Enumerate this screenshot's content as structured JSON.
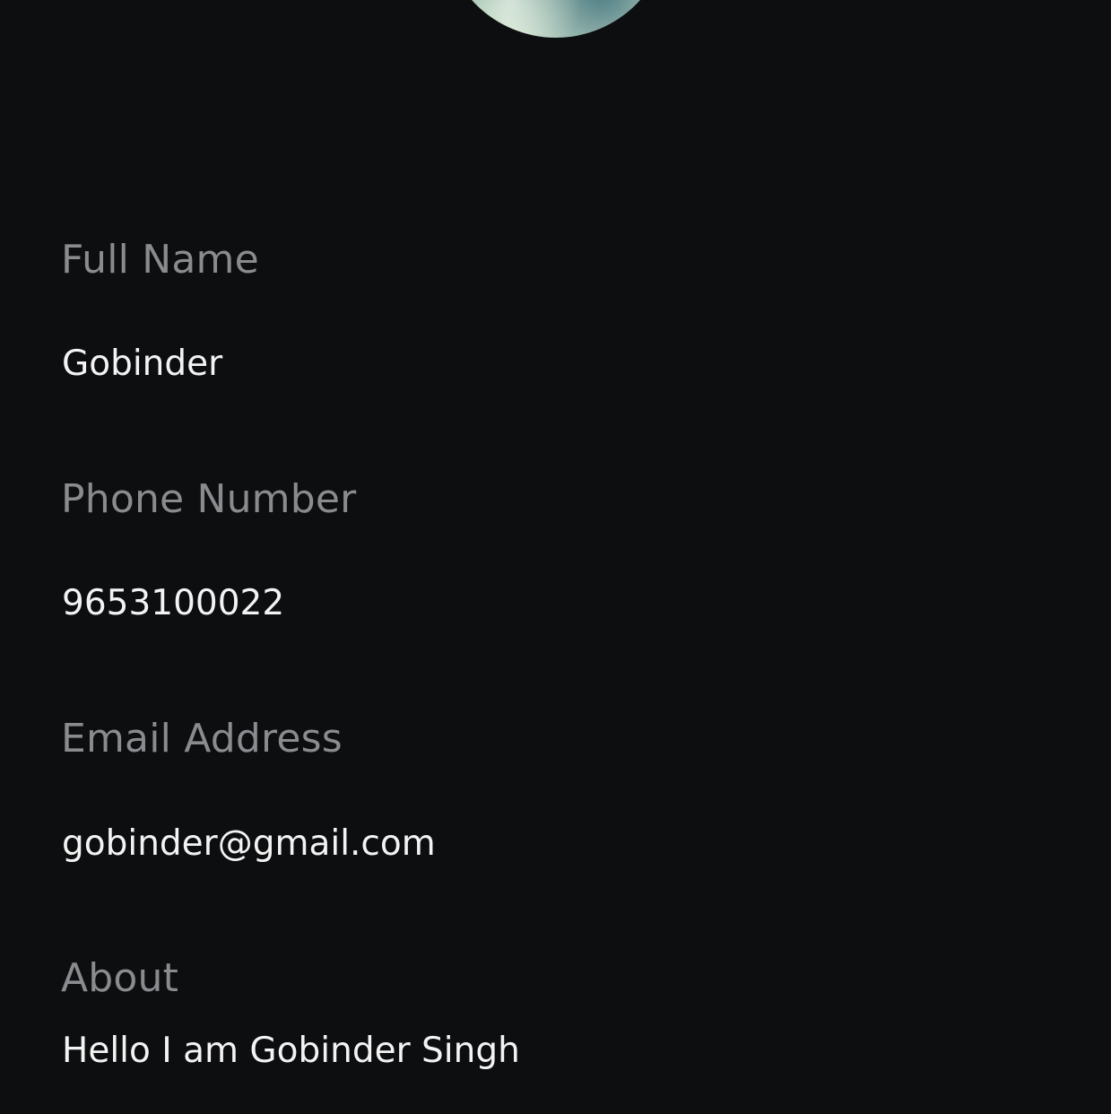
{
  "profile": {
    "fields": [
      {
        "label": "Full Name",
        "value": "Gobinder"
      },
      {
        "label": "Phone Number",
        "value": "9653100022"
      },
      {
        "label": "Email Address",
        "value": "gobinder@gmail.com"
      },
      {
        "label": "About",
        "value": "Hello I am Gobinder Singh"
      }
    ]
  },
  "colors": {
    "background": "#0d0e10",
    "label": "#8a8b8e",
    "value": "#f3f3f3"
  },
  "icons": {
    "avatar": "profile-photo"
  }
}
